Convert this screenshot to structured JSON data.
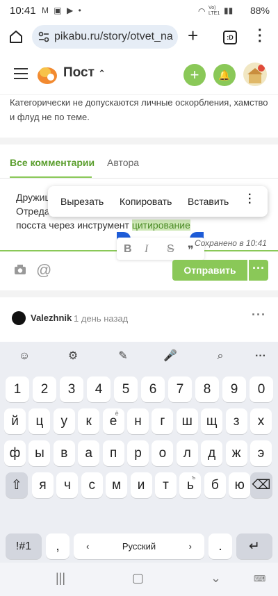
{
  "status_bar": {
    "time": "10:41",
    "battery": "88%",
    "notif_icons": "M ▣ ▶ •",
    "net": "Vo) LTE1"
  },
  "browser": {
    "url": "pikabu.ru/story/otvet_na",
    "tabs_label": ":D"
  },
  "site_header": {
    "title": "Пост"
  },
  "rules_text": "Категорически не допускаются личные оскорбления, хамство и флуд не по теме.",
  "comment_tabs": {
    "all": "Все комментарии",
    "author": "Автора"
  },
  "editor": {
    "line1": "Дружищ",
    "line2": "Отреда",
    "line3_pre": "посста через инструмент ",
    "line3_sel": "цитирование",
    "saved_label": "Сохранено в 10:41"
  },
  "context_menu": {
    "cut": "Вырезать",
    "copy": "Копировать",
    "paste": "Вставить"
  },
  "format_bar": {
    "bold": "B",
    "italic": "I",
    "strike": "S",
    "quote": "❞"
  },
  "send": {
    "label": "Отправить",
    "more": "···"
  },
  "comment": {
    "user": "Valezhnik",
    "time": "1 день назад"
  },
  "keyboard": {
    "row_numbers": [
      "1",
      "2",
      "3",
      "4",
      "5",
      "6",
      "7",
      "8",
      "9",
      "0"
    ],
    "row1": [
      "й",
      "ц",
      "у",
      "к",
      "е",
      "н",
      "г",
      "ш",
      "щ",
      "з",
      "х"
    ],
    "row1_sup": {
      "4": "ё"
    },
    "row2": [
      "ф",
      "ы",
      "в",
      "а",
      "п",
      "р",
      "о",
      "л",
      "д",
      "ж",
      "э"
    ],
    "row3": [
      "я",
      "ч",
      "с",
      "м",
      "и",
      "т",
      "ь",
      "б",
      "ю"
    ],
    "row3_sup": {
      "6": "ъ"
    },
    "symbols": "!#1",
    "comma": ",",
    "space": "Русский",
    "period": "."
  }
}
